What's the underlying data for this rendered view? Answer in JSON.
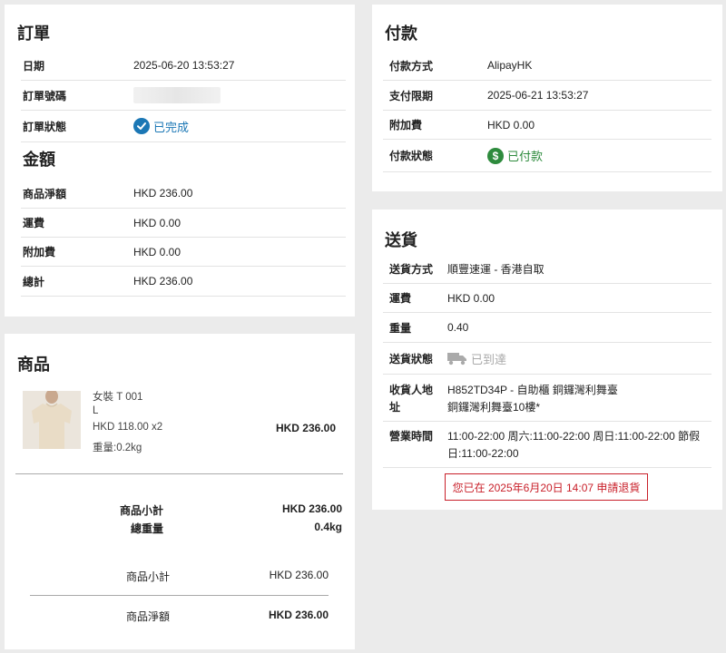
{
  "order": {
    "title": "訂單",
    "date_label": "日期",
    "date_value": "2025-06-20 13:53:27",
    "number_label": "訂單號碼",
    "status_label": "訂單狀態",
    "status_value": "已完成"
  },
  "amount": {
    "title": "金額",
    "rows": [
      {
        "label": "商品淨額",
        "value": "HKD 236.00"
      },
      {
        "label": "運費",
        "value": "HKD 0.00"
      },
      {
        "label": "附加費",
        "value": "HKD 0.00"
      },
      {
        "label": "總計",
        "value": "HKD 236.00"
      }
    ]
  },
  "payment": {
    "title": "付款",
    "method_label": "付款方式",
    "method_value": "AlipayHK",
    "deadline_label": "支付限期",
    "deadline_value": "2025-06-21 13:53:27",
    "surcharge_label": "附加費",
    "surcharge_value": "HKD 0.00",
    "status_label": "付款狀態",
    "status_value": "已付款"
  },
  "delivery": {
    "title": "送貨",
    "method_label": "送貨方式",
    "method_value": "順豐速運 - 香港自取",
    "fee_label": "運費",
    "fee_value": "HKD 0.00",
    "weight_label": "重量",
    "weight_value": "0.40",
    "status_label": "送貨狀態",
    "status_value": "已到達",
    "address_label": "收貨人地址",
    "address_line1": "H852TD34P - 自助櫃 銅鑼灣利舞臺",
    "address_line2": "銅鑼灣利舞臺10樓*",
    "hours_label": "營業時間",
    "hours_line1": "11:00-22:00 周六:11:00-22:00 周日:11:00-22:00 節假",
    "hours_line2": "日:11:00-22:00",
    "return_notice": "您已在 2025年6月20日 14:07 申請退貨"
  },
  "products": {
    "title": "商品",
    "items": [
      {
        "name": "女裝 T 001",
        "size": "L",
        "price_qty": "HKD 118.00 x2",
        "weight": "重量:0.2kg",
        "total": "HKD 236.00"
      }
    ],
    "subtotal_label": "商品小計",
    "subtotal_value": "HKD 236.00",
    "total_weight_label": "總重量",
    "total_weight_value": "0.4kg",
    "subtotal2_label": "商品小計",
    "subtotal2_value": "HKD 236.00",
    "net_label": "商品淨額",
    "net_value": "HKD 236.00"
  },
  "colors": {
    "background": "#ebebeb",
    "status_complete": "#1b77b5",
    "status_paid": "#2e8b3d",
    "status_delivered": "#aaaaaa",
    "return_notice": "#c9202a"
  }
}
